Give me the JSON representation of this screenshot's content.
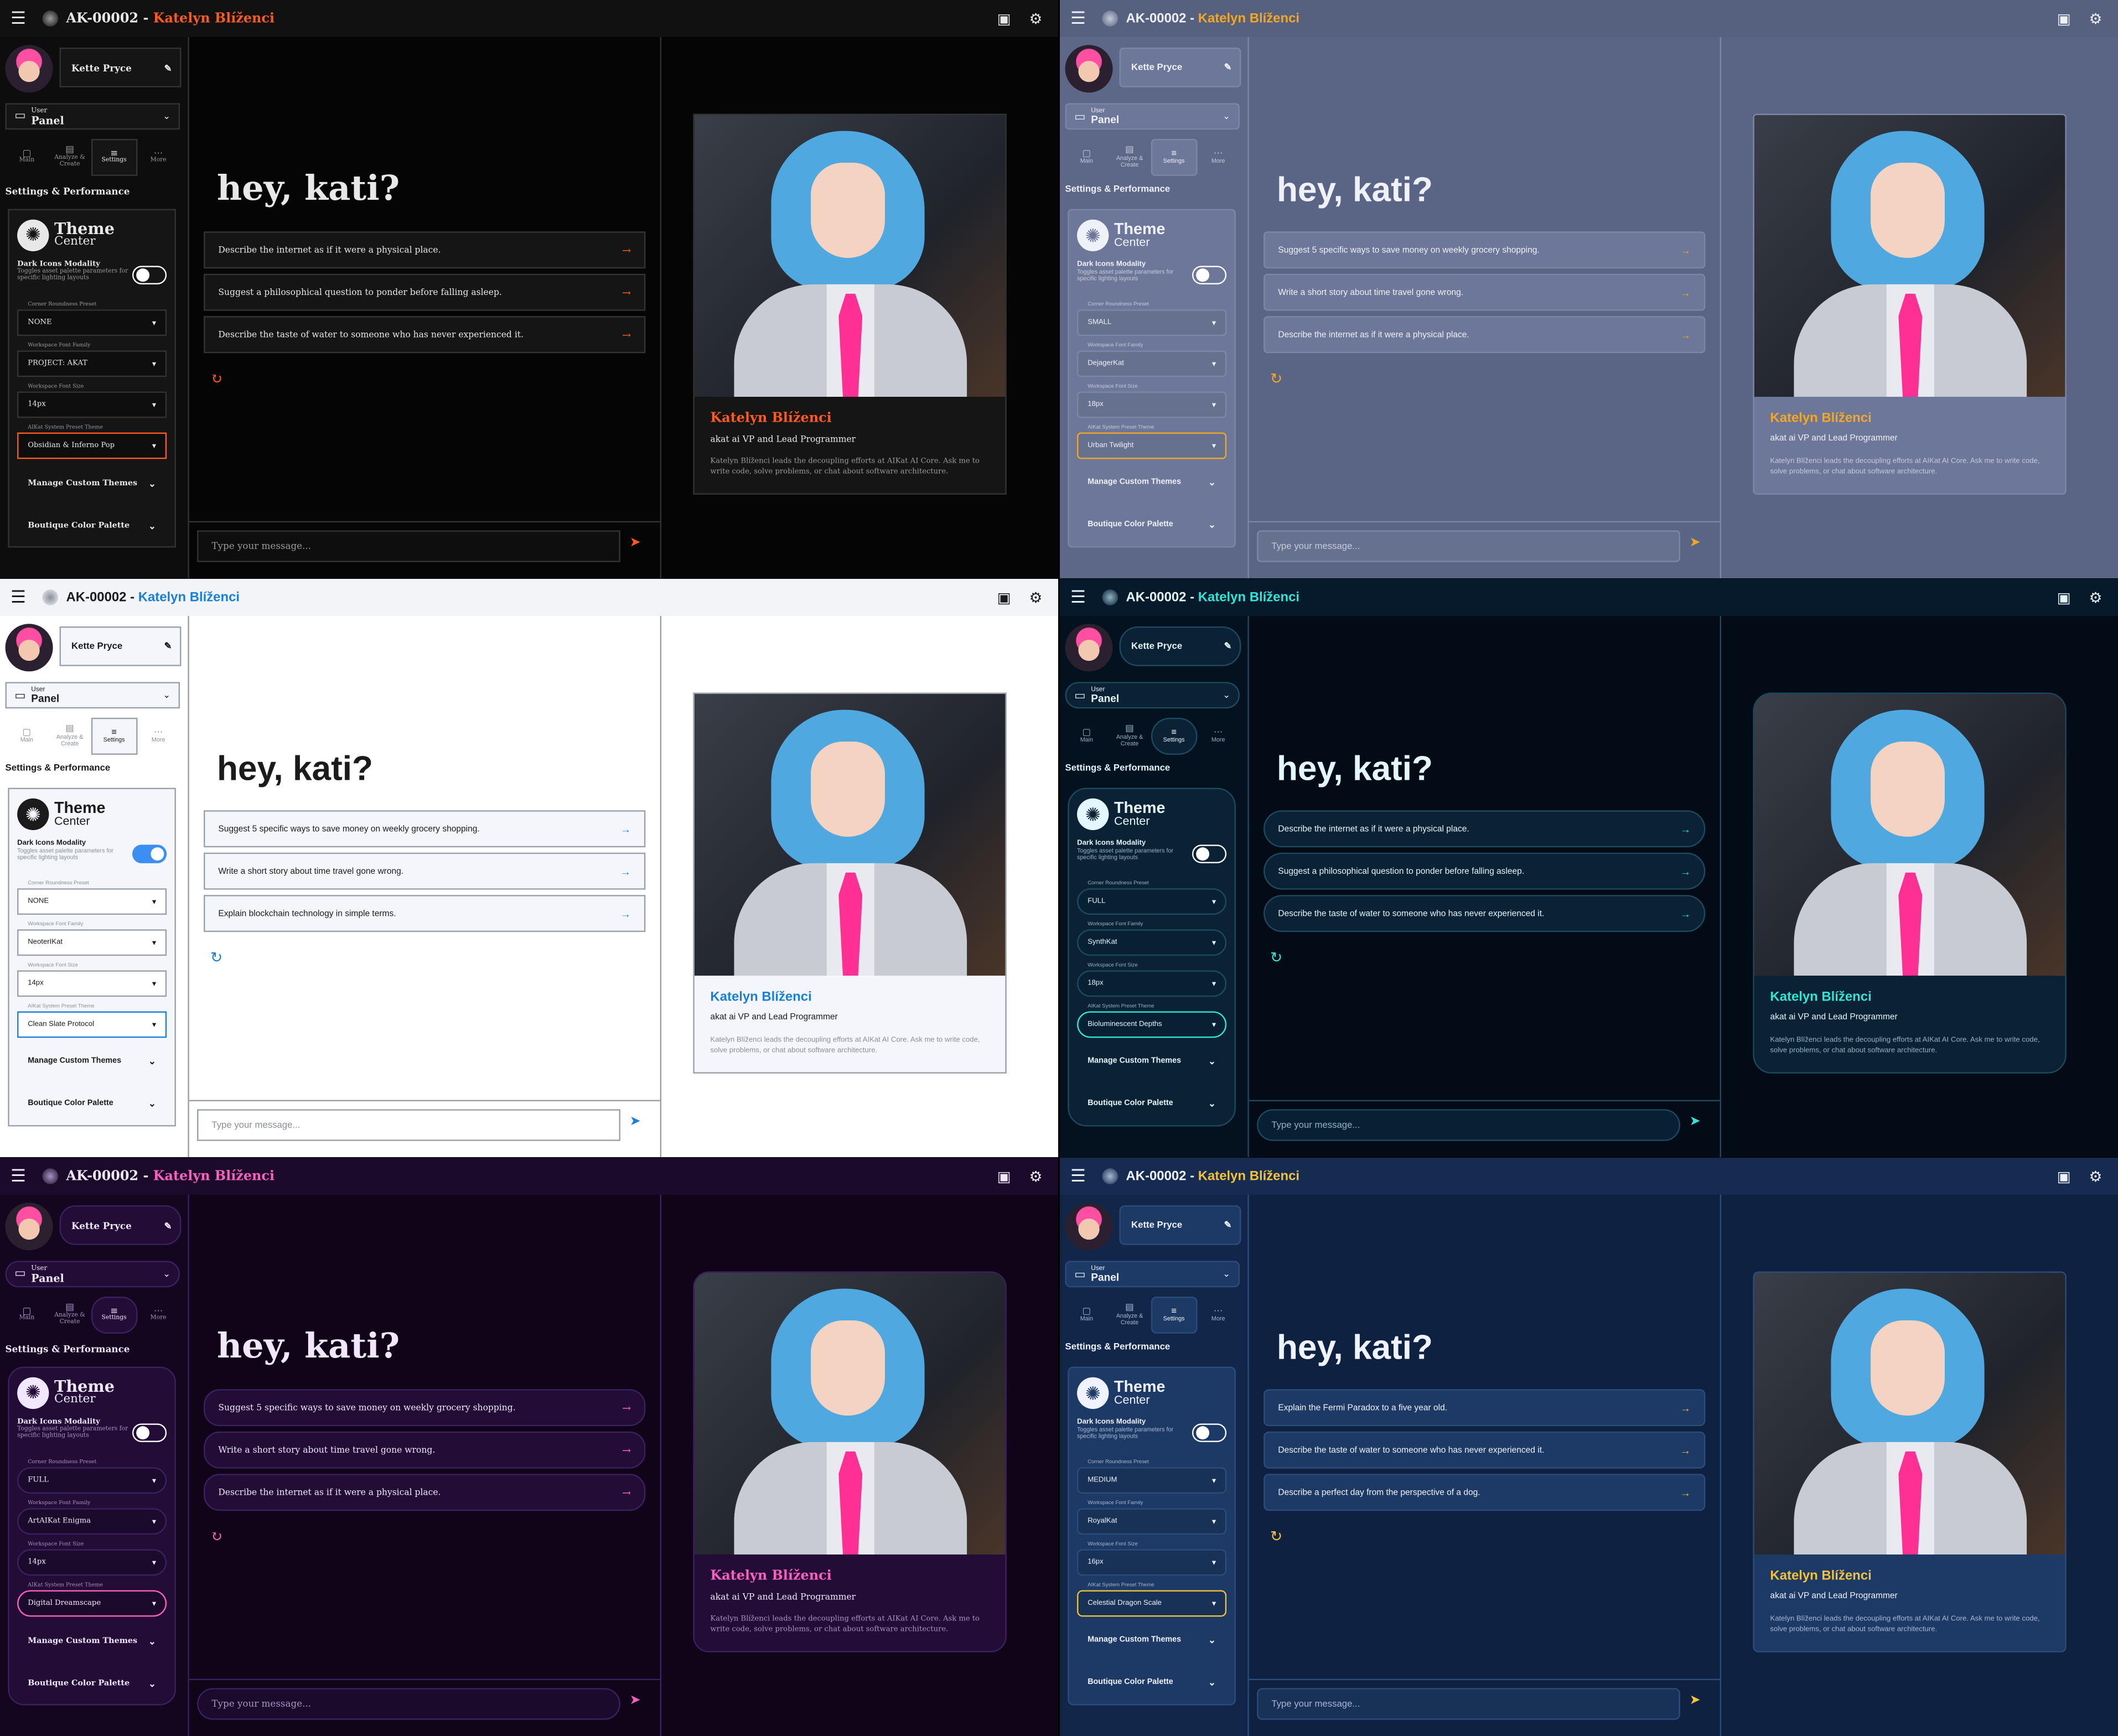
{
  "app": {
    "id": "AK-00002",
    "separator": " - ",
    "agent_name": "Katelyn Blíženci",
    "user_name": "Kette Pryce",
    "panel_small": "User",
    "panel_big": "Panel",
    "nav_tabs": [
      {
        "label": "Main",
        "icon": "chat-icon"
      },
      {
        "label": "Analyze & Create",
        "icon": "analyze-icon"
      },
      {
        "label": "Settings",
        "icon": "sliders-icon"
      },
      {
        "label": "More",
        "icon": "more-icon"
      }
    ],
    "section_title": "Settings & Performance",
    "theme_title_1": "Theme",
    "theme_title_2": "Center",
    "dark_icons_title": "Dark Icons Modality",
    "dark_icons_desc": "Toggles asset palette parameters for specific lighting layouts",
    "field_labels": [
      "Corner Roundness Preset",
      "Workspace Font Family",
      "Workspace Font Size",
      "AIKat System Preset Theme"
    ],
    "collapsibles": [
      "Manage Custom Themes",
      "Boutique Color Palette"
    ],
    "greeting": "hey, kati?",
    "input_placeholder": "Type your message...",
    "profile_role": "akat ai VP and Lead Programmer",
    "profile_desc": "Katelyn Blíženci leads the decoupling efforts at AIKat AI Core. Ask me to write code, solve problems, or chat about software architecture."
  },
  "variants": [
    {
      "name": "obsidian",
      "font_settings": {
        "corner": "NONE",
        "font": "PROJECT: AKAT",
        "size": "14px",
        "theme": "Obsidian & Inferno Pop"
      },
      "dark_icons_on": false,
      "suggestions": [
        "Describe the internet as if it were a physical place.",
        "Suggest a philosophical question to ponder before falling asleep.",
        "Describe the taste of water to someone who has never experienced it."
      ],
      "colors": {
        "bg": "#0a0a0a",
        "top": "#111111",
        "side": "#0d0d0d",
        "main": "#050505",
        "card": "#151515",
        "field": "#0e0e0e",
        "text": "#e8e8e8",
        "muted": "#9a9a9a",
        "accent": "#ff5a1f",
        "border": "#333333",
        "toggle": "#ffffff"
      }
    },
    {
      "name": "urban",
      "font_settings": {
        "corner": "SMALL",
        "font": "DejagerKat",
        "size": "18px",
        "theme": "Urban Twilight"
      },
      "dark_icons_on": false,
      "suggestions": [
        "Suggest 5 specific ways to save money on weekly grocery shopping.",
        "Write a short story about time travel gone wrong.",
        "Describe the internet as if it were a physical place."
      ],
      "colors": {
        "bg": "#5b6585",
        "top": "#56607f",
        "side": "#5d6788",
        "main": "#5a6485",
        "card": "#6d7799",
        "field": "#66708f",
        "text": "#eef1f8",
        "muted": "#c4cadb",
        "accent": "#f5a623",
        "border": "#7c86a6",
        "toggle": "#ffffff"
      }
    },
    {
      "name": "clean",
      "font_settings": {
        "corner": "NONE",
        "font": "NeoterIKat",
        "size": "14px",
        "theme": "Clean Slate Protocol"
      },
      "dark_icons_on": true,
      "suggestions": [
        "Suggest 5 specific ways to save money on weekly grocery shopping.",
        "Write a short story about time travel gone wrong.",
        "Explain blockchain technology in simple terms."
      ],
      "colors": {
        "bg": "#ffffff",
        "top": "#f3f4f8",
        "side": "#ffffff",
        "main": "#ffffff",
        "card": "#f4f6fb",
        "field": "#ffffff",
        "text": "#1b1b1b",
        "muted": "#8a8f99",
        "accent": "#1a7fd6",
        "border": "#9aa0aa",
        "toggle": "#3b8ef2"
      }
    },
    {
      "name": "biolum",
      "font_settings": {
        "corner": "FULL",
        "font": "SynthKat",
        "size": "18px",
        "theme": "Bioluminescent Depths"
      },
      "dark_icons_on": false,
      "suggestions": [
        "Describe the internet as if it were a physical place.",
        "Suggest a philosophical question to ponder before falling asleep.",
        "Describe the taste of water to someone who has never experienced it."
      ],
      "colors": {
        "bg": "#03101f",
        "top": "#061a2b",
        "side": "#04111f",
        "main": "#030b17",
        "card": "#0b2235",
        "field": "#072034",
        "text": "#e4f6ff",
        "muted": "#8fb3c4",
        "accent": "#2ee6d6",
        "border": "#1c4a5e",
        "toggle": "#ffffff"
      }
    },
    {
      "name": "dream",
      "font_settings": {
        "corner": "FULL",
        "font": "ArtAIKat Enigma",
        "size": "14px",
        "theme": "Digital Dreamscape"
      },
      "dark_icons_on": false,
      "suggestions": [
        "Suggest 5 specific ways to save money on weekly grocery shopping.",
        "Write a short story about time travel gone wrong.",
        "Describe the internet as if it were a physical place."
      ],
      "colors": {
        "bg": "#14051f",
        "top": "#1c0a2b",
        "side": "#150620",
        "main": "#0f0418",
        "card": "#230c36",
        "field": "#1c0a2c",
        "text": "#f1e8ff",
        "muted": "#a893c2",
        "accent": "#ff5fc1",
        "border": "#3d2060",
        "toggle": "#ffffff"
      }
    },
    {
      "name": "celestial",
      "font_settings": {
        "corner": "MEDIUM",
        "font": "RoyalKat",
        "size": "16px",
        "theme": "Celestial Dragon Scale"
      },
      "dark_icons_on": false,
      "suggestions": [
        "Explain the Fermi Paradox to a five year old.",
        "Describe the taste of water to someone who has never experienced it.",
        "Describe a perfect day from the perspective of a dog."
      ],
      "colors": {
        "bg": "#13284a",
        "top": "#152b50",
        "side": "#12264a",
        "main": "#0f2140",
        "card": "#1d3a66",
        "field": "#183157",
        "text": "#eef3ff",
        "muted": "#a7b6d3",
        "accent": "#f5c13b",
        "border": "#2c4c7c",
        "toggle": "#ffffff"
      }
    }
  ]
}
